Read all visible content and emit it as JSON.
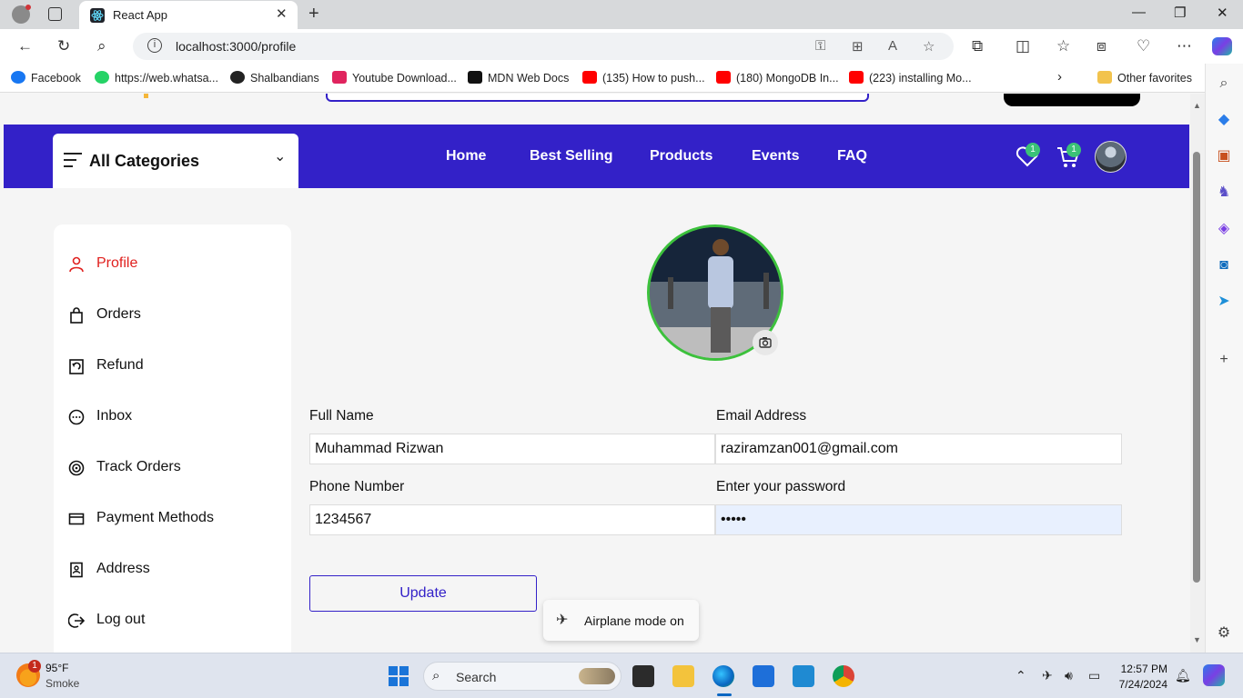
{
  "browser": {
    "tab_title": "React App",
    "url": "localhost:3000/profile",
    "favorites": [
      {
        "label": "Facebook",
        "color": "#1877f2"
      },
      {
        "label": "https://web.whatsa...",
        "color": "#25d366"
      },
      {
        "label": "Shalbandians",
        "color": "#222222"
      },
      {
        "label": "Youtube Download...",
        "color": "#e0245e"
      },
      {
        "label": "MDN Web Docs",
        "color": "#111111"
      },
      {
        "label": "(135) How to push...",
        "color": "#ff0000"
      },
      {
        "label": "(180) MongoDB In...",
        "color": "#ff0000"
      },
      {
        "label": "(223) installing Mo...",
        "color": "#ff0000"
      }
    ],
    "other_favorites": "Other favorites"
  },
  "header": {
    "categories_label": "All Categories",
    "menu": [
      "Home",
      "Best Selling",
      "Products",
      "Events",
      "FAQ"
    ],
    "wishlist_count": "1",
    "cart_count": "1",
    "color": "#3321c8"
  },
  "sidebar": {
    "items": [
      {
        "label": "Profile",
        "icon": "person-icon",
        "active": true
      },
      {
        "label": "Orders",
        "icon": "bag-icon",
        "active": false
      },
      {
        "label": "Refund",
        "icon": "refund-icon",
        "active": false
      },
      {
        "label": "Inbox",
        "icon": "chat-icon",
        "active": false
      },
      {
        "label": "Track Orders",
        "icon": "track-icon",
        "active": false
      },
      {
        "label": "Payment Methods",
        "icon": "card-icon",
        "active": false
      },
      {
        "label": "Address",
        "icon": "address-book-icon",
        "active": false
      },
      {
        "label": "Log out",
        "icon": "logout-icon",
        "active": false
      }
    ]
  },
  "form": {
    "full_name_label": "Full Name",
    "full_name_value": "Muhammad Rizwan",
    "email_label": "Email Address",
    "email_value": "raziramzan001@gmail.com",
    "phone_label": "Phone Number",
    "phone_value": "1234567",
    "password_label": "Enter your password",
    "password_value": "•••••",
    "update_label": "Update"
  },
  "toast": {
    "label": "Airplane mode on"
  },
  "taskbar": {
    "weather_badge": "1",
    "temperature": "95°F",
    "condition": "Smoke",
    "search_label": "Search",
    "time": "12:57 PM",
    "date": "7/24/2024"
  }
}
